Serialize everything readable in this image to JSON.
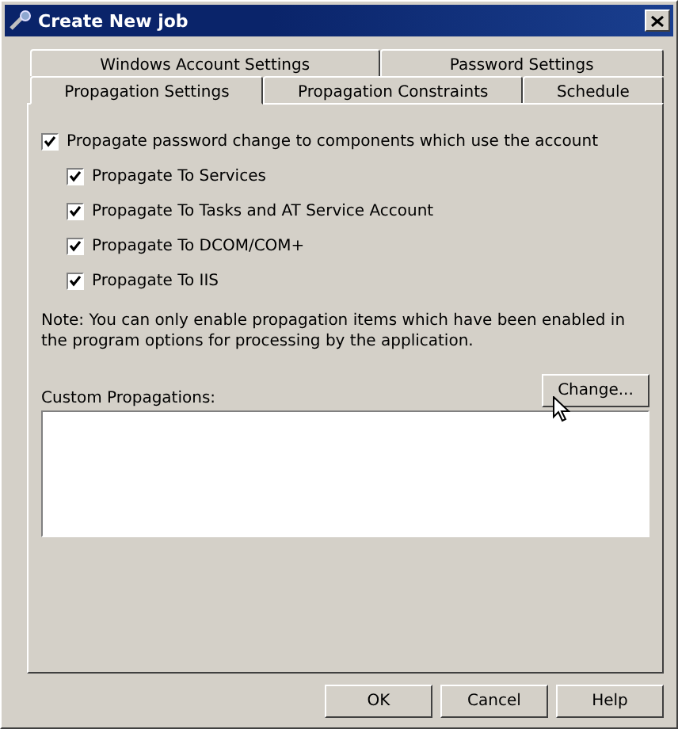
{
  "window": {
    "title": "Create New job"
  },
  "tab_rows": [
    [
      {
        "label": "Windows Account Settings",
        "selected": false
      },
      {
        "label": "Password Settings",
        "selected": false
      }
    ],
    [
      {
        "label": "Propagation Settings",
        "selected": true
      },
      {
        "label": "Propagation Constraints",
        "selected": false
      },
      {
        "label": "Schedule",
        "selected": false
      }
    ]
  ],
  "propagate": {
    "label": "Propagate password change to components which use the account",
    "checked": true,
    "children": [
      {
        "label": "Propagate To Services",
        "checked": true
      },
      {
        "label": "Propagate To Tasks and AT Service Account",
        "checked": true
      },
      {
        "label": "Propagate To DCOM/COM+",
        "checked": true
      },
      {
        "label": "Propagate To IIS",
        "checked": true
      }
    ]
  },
  "note": "Note: You can only enable propagation items which have been enabled in the program options for processing by the application.",
  "custom_propagations": {
    "label": "Custom Propagations:",
    "button": "Change..."
  },
  "buttons": [
    "OK",
    "Cancel",
    "Help"
  ]
}
